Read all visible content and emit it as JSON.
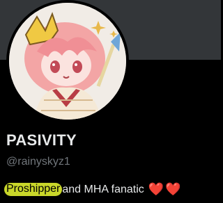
{
  "profile": {
    "display_name": "PASIVITY",
    "handle": "@rainyskyz1",
    "bio": {
      "highlighted_word": "Proshipper",
      "text": " and MHA fanatic",
      "emoji": "❤️❤️"
    }
  },
  "colors": {
    "banner": "#333639",
    "background": "#000000",
    "highlight": "#c9d72a",
    "heart": "#d8182b",
    "handle": "#71767b"
  },
  "icons": [
    "avatar-illustration",
    "red-heart-emoji"
  ]
}
